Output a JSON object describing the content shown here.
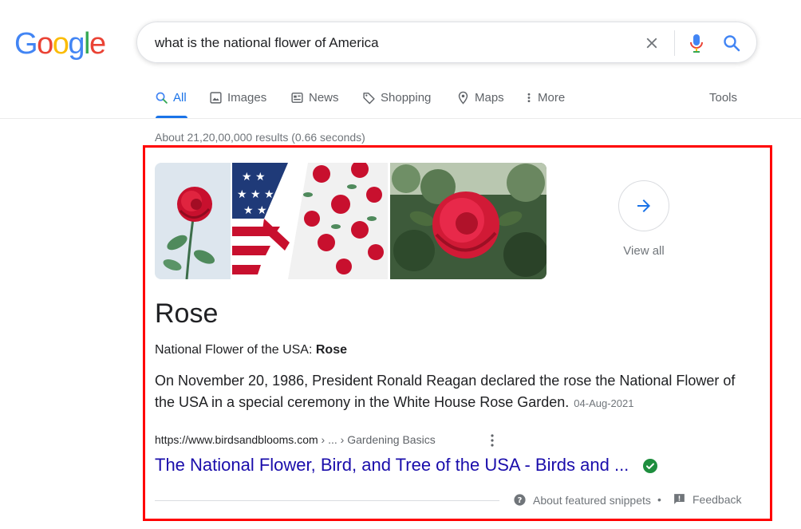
{
  "logo": {
    "letters": [
      "G",
      "o",
      "o",
      "g",
      "l",
      "e"
    ]
  },
  "search": {
    "query": "what is the national flower of America"
  },
  "tabs": [
    {
      "label": "All",
      "icon": "search-icon"
    },
    {
      "label": "Images",
      "icon": "image-icon"
    },
    {
      "label": "News",
      "icon": "news-icon"
    },
    {
      "label": "Shopping",
      "icon": "tag-icon"
    },
    {
      "label": "Maps",
      "icon": "map-pin-icon"
    },
    {
      "label": "More",
      "icon": "more-vert-icon"
    }
  ],
  "tools_label": "Tools",
  "result_stats": "About 21,20,00,000 results (0.66 seconds)",
  "featured": {
    "view_all_label": "View all",
    "title": "Rose",
    "subtitle_prefix": "National Flower of the USA: ",
    "subtitle_bold": "Rose",
    "description": "On November 20, 1986, President Ronald Reagan declared the rose the National Flower of the USA in a special ceremony in the White House Rose Garden.",
    "date": "04-Aug-2021",
    "source_url": "https://www.birdsandblooms.com",
    "source_crumb": " › ... › Gardening Basics",
    "link_title": "The National Flower, Bird, and Tree of the USA - Birds and ...",
    "about_snippets": "About featured snippets",
    "separator": "•",
    "feedback": "Feedback"
  },
  "colors": {
    "google_blue": "#4285f4",
    "google_red": "#ea4335",
    "google_yellow": "#fbbc05",
    "google_green": "#34a853",
    "active_tab": "#1a73e8",
    "link": "#1a0dab",
    "highlight_border": "#ff0000"
  }
}
